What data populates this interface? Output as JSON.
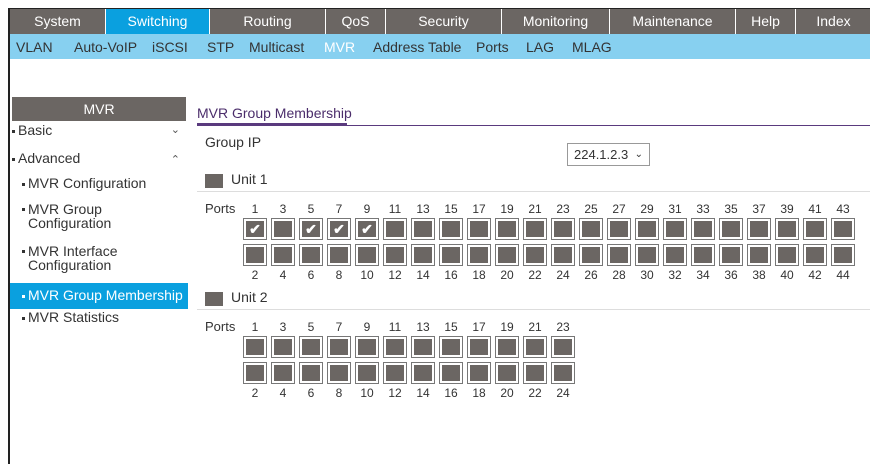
{
  "topnav": [
    {
      "label": "System",
      "active": false
    },
    {
      "label": "Switching",
      "active": true
    },
    {
      "label": "Routing",
      "active": false
    },
    {
      "label": "QoS",
      "active": false
    },
    {
      "label": "Security",
      "active": false
    },
    {
      "label": "Monitoring",
      "active": false
    },
    {
      "label": "Maintenance",
      "active": false
    },
    {
      "label": "Help",
      "active": false
    },
    {
      "label": "Index",
      "active": false
    }
  ],
  "subnav": [
    {
      "label": "VLAN",
      "active": false
    },
    {
      "label": "Auto-VoIP",
      "active": false
    },
    {
      "label": "iSCSI",
      "active": false
    },
    {
      "label": "STP",
      "active": false
    },
    {
      "label": "Multicast",
      "active": false
    },
    {
      "label": "MVR",
      "active": true
    },
    {
      "label": "Address Table",
      "active": false
    },
    {
      "label": "Ports",
      "active": false
    },
    {
      "label": "LAG",
      "active": false
    },
    {
      "label": "MLAG",
      "active": false
    }
  ],
  "sidebar": {
    "title": "MVR",
    "basic": "Basic",
    "advanced": "Advanced",
    "items": [
      {
        "label": "MVR Configuration",
        "active": false
      },
      {
        "label": "MVR Group Configuration",
        "active": false
      },
      {
        "label": "MVR Interface Configuration",
        "active": false
      },
      {
        "label": "MVR Group Membership",
        "active": true
      },
      {
        "label": "MVR Statistics",
        "active": false
      }
    ]
  },
  "main": {
    "title": "MVR Group Membership",
    "group_ip_label": "Group IP",
    "group_ip_value": "224.1.2.3",
    "ports_label": "Ports",
    "units": [
      {
        "label": "Unit 1",
        "port_count": 44,
        "checked": [
          1,
          5,
          7,
          9
        ]
      },
      {
        "label": "Unit 2",
        "port_count": 24,
        "checked": []
      }
    ]
  }
}
